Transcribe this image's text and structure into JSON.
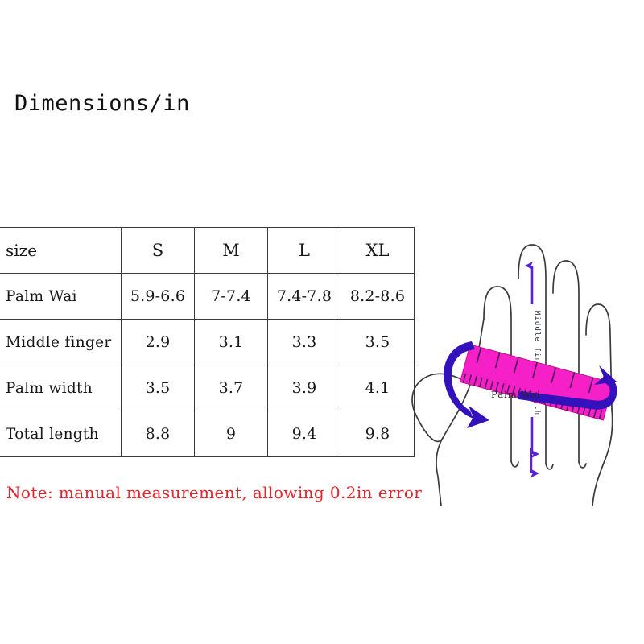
{
  "page": {
    "title": "Dimensions/in",
    "background_color": "#ffffff"
  },
  "table": {
    "columns": [
      "size",
      "S",
      "M",
      "L",
      "XL"
    ],
    "rows": [
      {
        "label": "Palm Wai",
        "values": [
          "5.9-6.6",
          "7-7.4",
          "7.4-7.8",
          "8.2-8.6"
        ]
      },
      {
        "label": "Middle finger",
        "values": [
          "2.9",
          "3.1",
          "3.3",
          "3.5"
        ]
      },
      {
        "label": "Palm width",
        "values": [
          "3.5",
          "3.7",
          "3.9",
          "4.1"
        ]
      },
      {
        "label": "Total length",
        "values": [
          "8.8",
          "9",
          "9.4",
          "9.8"
        ]
      }
    ],
    "border_color": "#3a3a3a"
  },
  "note": {
    "text": "Note: manual measurement, allowing 0.2in error",
    "color": "#e8222a"
  },
  "diagram": {
    "middle_finger_label": "Middle finger length",
    "palm_label": "Palm Wai",
    "arrow_color": "#5b21d6",
    "wrap_arrow_color": "#3311bb",
    "ruler_color": "#f520c8",
    "ruler_tick_color": "#6b1060",
    "hand_outline_color": "#3b3b3b"
  }
}
